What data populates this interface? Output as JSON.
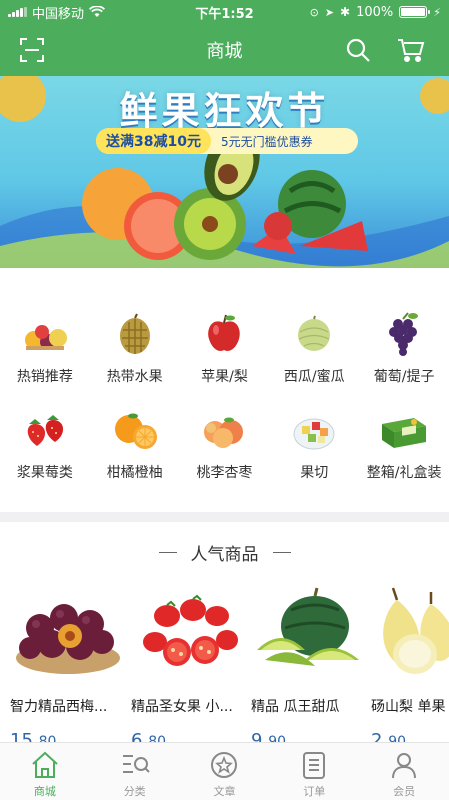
{
  "status_bar": {
    "carrier": "中国移动",
    "time": "下午1:52",
    "battery": "100%"
  },
  "header": {
    "title": "商城"
  },
  "banner": {
    "title": "鲜果狂欢节",
    "coupon_main": "送满38减10元",
    "coupon_sub": "5元无门槛优惠券"
  },
  "categories": [
    {
      "label": "热销推荐",
      "icon": "mixed-fruit-icon"
    },
    {
      "label": "热带水果",
      "icon": "durian-icon"
    },
    {
      "label": "苹果/梨",
      "icon": "apple-icon"
    },
    {
      "label": "西瓜/蜜瓜",
      "icon": "melon-icon"
    },
    {
      "label": "葡萄/提子",
      "icon": "grape-icon"
    },
    {
      "label": "浆果莓类",
      "icon": "strawberry-icon"
    },
    {
      "label": "柑橘橙柚",
      "icon": "orange-icon"
    },
    {
      "label": "桃李杏枣",
      "icon": "peach-icon"
    },
    {
      "label": "果切",
      "icon": "fruit-cut-icon"
    },
    {
      "label": "整箱/礼盒装",
      "icon": "gift-box-icon"
    }
  ],
  "section": {
    "title": "人气商品"
  },
  "products": [
    {
      "name": "智力精品西梅...",
      "price_int": "15.",
      "price_dec": "80"
    },
    {
      "name": "精品圣女果 小...",
      "price_int": "6.",
      "price_dec": "80"
    },
    {
      "name": "精品 瓜王甜瓜",
      "price_int": "9.",
      "price_dec": "90"
    },
    {
      "name": "砀山梨  单果",
      "price_int": "2.",
      "price_dec": "90"
    }
  ],
  "tabs": [
    {
      "label": "商城",
      "icon": "home-icon",
      "active": true
    },
    {
      "label": "分类",
      "icon": "category-search-icon",
      "active": false
    },
    {
      "label": "文章",
      "icon": "star-circle-icon",
      "active": false
    },
    {
      "label": "订单",
      "icon": "order-list-icon",
      "active": false
    },
    {
      "label": "会员",
      "icon": "user-icon",
      "active": false
    }
  ],
  "colors": {
    "brand": "#4cae5c",
    "price": "#2f66a8"
  }
}
